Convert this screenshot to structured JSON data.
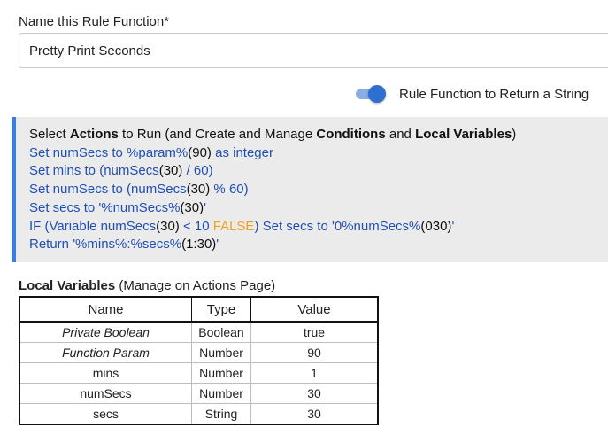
{
  "name_field": {
    "label": "Name this Rule Function*",
    "value": "Pretty Print Seconds"
  },
  "return_string_toggle": {
    "label": "Rule Function to Return a String",
    "checked": true
  },
  "actions": {
    "header": {
      "select": "Select ",
      "actions": "Actions",
      "to_run": " to Run (and Create and Manage ",
      "conditions": "Conditions",
      "and": " and ",
      "local_variables": "Local Variables",
      "close": ")"
    },
    "lines": [
      {
        "a": "Set numSecs to %param%",
        "b": "(90)",
        "c": " as integer"
      },
      {
        "a": "Set mins to (numSecs",
        "b": "(30)",
        "c": " / 60)"
      },
      {
        "a": "Set numSecs to (numSecs",
        "b": "(30)",
        "c": " % 60)"
      },
      {
        "a": "Set secs to '%numSecs%",
        "b": "(30)",
        "c": "'"
      },
      {
        "a": "IF (Variable numSecs",
        "b": "(30)",
        "c": " < 10 ",
        "d": "FALSE",
        "e": ") Set secs to '0%numSecs%",
        "f": "(030)",
        "g": "'"
      },
      {
        "a": "Return '%mins%:%secs%",
        "b": "(1:30)",
        "c": "'"
      }
    ]
  },
  "local_variables": {
    "title": "Local Variables",
    "subtitle": " (Manage on Actions Page)",
    "columns": [
      "Name",
      "Type",
      "Value"
    ],
    "rows": [
      {
        "name": "Private Boolean",
        "type": "Boolean",
        "value": "true"
      },
      {
        "name": "Function Param",
        "type": "Number",
        "value": "90"
      },
      {
        "name": "mins",
        "type": "Number",
        "value": "1"
      },
      {
        "name": "numSecs",
        "type": "Number",
        "value": "30"
      },
      {
        "name": "secs",
        "type": "String",
        "value": "30"
      }
    ]
  },
  "colors": {
    "accent": "#3b7dd8",
    "action_text": "#1f4fb4",
    "false_text": "#f0a020",
    "panel_bg": "#ebebeb"
  }
}
